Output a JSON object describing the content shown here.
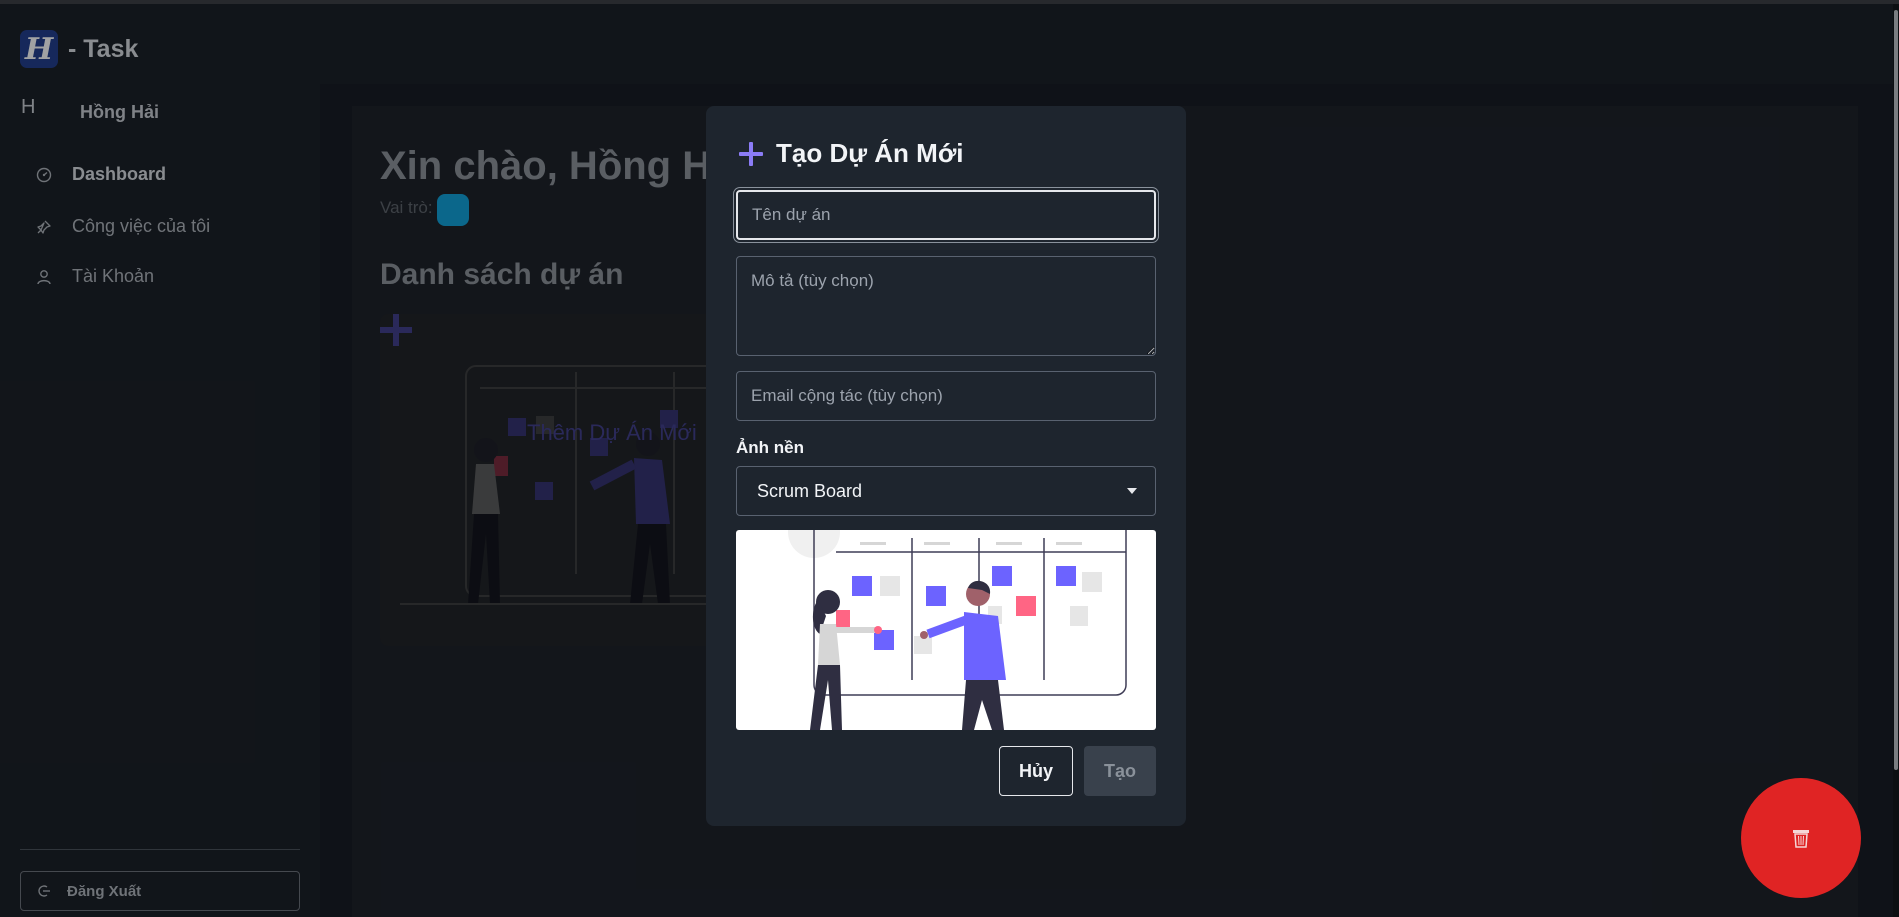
{
  "app": {
    "brand_letter": "H",
    "title": "- Task"
  },
  "user": {
    "initial": "H",
    "name": "Hồng Hải"
  },
  "sidebar": {
    "items": [
      {
        "label": "Dashboard",
        "icon": "dashboard-gauge-icon",
        "active": true
      },
      {
        "label": "Công việc của tôi",
        "icon": "pin-icon",
        "active": false
      },
      {
        "label": "Tài Khoản",
        "icon": "user-icon",
        "active": false
      }
    ],
    "logout_label": "Đăng Xuất",
    "logout_icon": "logout-icon"
  },
  "main": {
    "greeting": "Xin chào, Hồng Hải",
    "role_label": "Vai trò:",
    "section_title": "Danh sách dự án",
    "add_project_label": "Thêm Dự Án Mới"
  },
  "modal": {
    "title": "Tạo Dự Án Mới",
    "name_placeholder": "Tên dự án",
    "description_placeholder": "Mô tả (tùy chọn)",
    "email_placeholder": "Email cộng tác (tùy chọn)",
    "background_label": "Ảnh nền",
    "background_selected": "Scrum Board",
    "cancel_label": "Hủy",
    "create_label": "Tạo"
  },
  "fab": {
    "icon": "trash-icon",
    "color": "#e02424"
  },
  "colors": {
    "accent": "#6c63ff",
    "role_badge": "#0ea0d8",
    "illustration_pink": "#ff6584"
  }
}
